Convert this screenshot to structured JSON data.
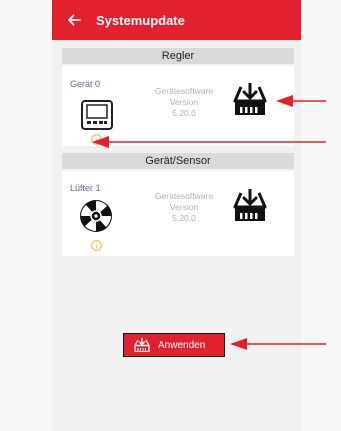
{
  "header": {
    "title": "Systemupdate"
  },
  "sections": {
    "regler": "Regler",
    "geraet_sensor": "Gerät/Sensor"
  },
  "devices": [
    {
      "name": "Gerät 0",
      "sw_label": "Gerätesoftware",
      "sw_version_label": "Version",
      "sw_version": "5.20.0"
    },
    {
      "name": "Lüfter 1",
      "sw_label": "Gerätesoftware",
      "sw_version_label": "Version",
      "sw_version": "5.20.0"
    }
  ],
  "apply_button": {
    "label": "Anwenden"
  },
  "colors": {
    "accent": "#e3202d",
    "info": "#f0a52a",
    "annotation_arrow": "#e3202d"
  },
  "icons": [
    "back-arrow-icon",
    "thermostat-device-icon",
    "fan-icon",
    "info-icon",
    "download-icon"
  ]
}
